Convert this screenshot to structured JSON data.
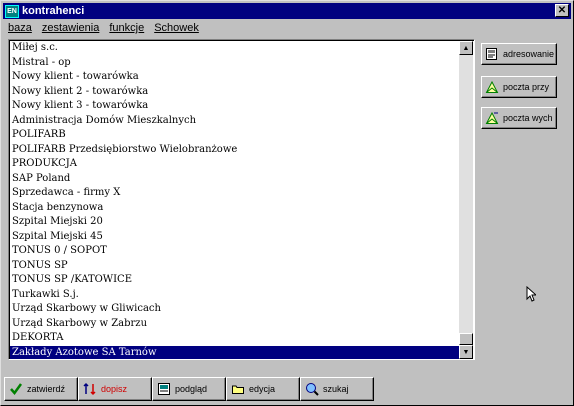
{
  "window": {
    "title": "kontrahenci",
    "icon": "app-icon",
    "icon_text": "EN",
    "close_symbol": "✕"
  },
  "menu": [
    "baza",
    "zestawienia",
    "funkcje",
    "Schowek"
  ],
  "list": {
    "items": [
      "Miłej s.c.",
      "Mistral - op",
      "Nowy klient - towarówka",
      "Nowy klient 2 - towarówka",
      "Nowy klient 3 - towarówka",
      "Administracja Domów Mieszkalnych",
      "POLIFARB",
      "POLIFARB Przedsiębiorstwo Wielobranżowe",
      "PRODUKCJA",
      "SAP Poland",
      "Sprzedawca - firmy X",
      "Stacja benzynowa",
      "Szpital Miejski 20",
      "Szpital Miejski 45",
      "TONUS 0 / SOPOT",
      "TONUS SP",
      "TONUS SP /KATOWICE",
      "Turkawki S.j.",
      "Urząd Skarbowy w Gliwicach",
      "Urząd Skarbowy w Zabrzu",
      "DEKORTA",
      "Zakłady Azotowe SA Tarnów"
    ],
    "selected_index": 21,
    "scroll_position": 1.0
  },
  "side_buttons": [
    {
      "label": "adresowanie",
      "icon": "address-book-icon"
    },
    {
      "label": "poczta przy",
      "icon": "mail-in-icon"
    },
    {
      "label": "poczta wych",
      "icon": "mail-out-icon"
    }
  ],
  "bottom_buttons": [
    {
      "label": "zatwierdź",
      "icon": "checkmark-icon"
    },
    {
      "label": "dopisz",
      "icon": "add-record-icon",
      "color": "#d00000"
    },
    {
      "label": "podgląd",
      "icon": "preview-icon"
    },
    {
      "label": "edycja",
      "icon": "folder-icon"
    },
    {
      "label": "szukaj",
      "icon": "search-icon"
    }
  ],
  "colors": {
    "title_bar": "#000080",
    "selection": "#000080",
    "face": "#c0c0c0",
    "accent_red": "#d00000",
    "accent_green": "#008000"
  }
}
